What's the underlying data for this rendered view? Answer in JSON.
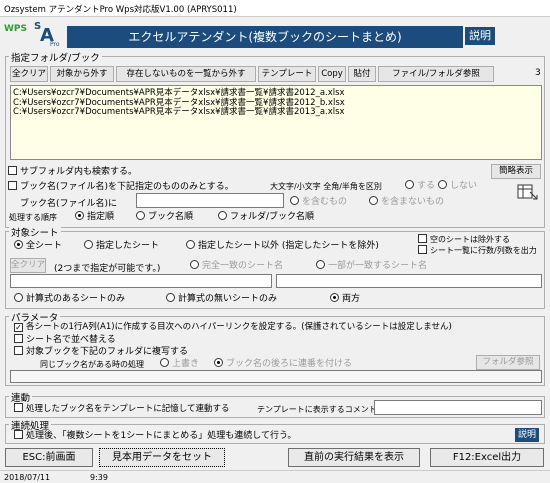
{
  "window": {
    "title": "Ozsystem アテンダントPro Wps対応版V1.00 (APRYS011)"
  },
  "logo": {
    "wps": "WPS",
    "s": "S",
    "a": "A",
    "pro": "Pro"
  },
  "banner": {
    "title": "エクセルアテンダント(複数ブックのシートまとめ)",
    "help": "説明"
  },
  "folder_group": {
    "label": "指定フォルダ/ブック",
    "buttons": [
      "全クリア",
      "対象から外す",
      "存在しないものを一覧から外す",
      "テンプレート",
      "Copy",
      "貼付",
      "ファイル/フォルダ参照"
    ],
    "count": "3",
    "files": [
      "C:¥Users¥ozcr7¥Documents¥APR見本データxlsx¥請求書一覧¥請求書2012_a.xlsx",
      "C:¥Users¥ozcr7¥Documents¥APR見本データxlsx¥請求書一覧¥請求書2012_b.xlsx",
      "C:¥Users¥ozcr7¥Documents¥APR見本データxlsx¥請求書一覧¥請求書2013_a.xlsx"
    ],
    "subfolder": "サブフォルダ内も検索する。",
    "simple_button": "簡略表示",
    "bookname_filter": "ブック名(ファイル名)を下記指定のもののみとする。",
    "case_label": "大文字/小文字 全角/半角を区別",
    "case_yes": "する",
    "case_no": "しない",
    "bookname_label": "ブック名(ファイル名)に",
    "contains": "を含むもの",
    "not_contains": "を含まないもの",
    "order_label": "処理する順序",
    "order_options": [
      "指定順",
      "ブック名順",
      "フォルダ/ブック名順"
    ]
  },
  "sheet_group": {
    "label": "対象シート",
    "options": [
      "全シート",
      "指定したシート",
      "指定したシート以外 (指定したシートを除外)"
    ],
    "exclude_empty": "空のシートは除外する",
    "output_rows": "シート一覧に行数/列数を出力",
    "clear": "全クリア",
    "note": "(2つまで指定が可能です。)",
    "match_full": "完全一致のシート名",
    "match_part": "一部が一致するシート名",
    "formula_options": [
      "計算式のあるシートのみ",
      "計算式の無いシートのみ",
      "両方"
    ]
  },
  "param_group": {
    "label": "パラメータ",
    "hyperlink": "各シートの1行A列(A1)に作成する目次へのハイパーリンクを設定する。(保護されているシートは設定しません)",
    "sort": "シート名で並べ替える",
    "copy_to_folder": "対象ブックを下記のフォルダに複写する",
    "same_name_label": "同じブック名がある時の処理",
    "overwrite": "上書き",
    "serial": "ブック名の後ろに連番を付ける",
    "folder_button": "フォルダ参照"
  },
  "link_group": {
    "label": "連動",
    "remember": "処理したブック名をテンプレートに記憶して連動する",
    "comment_label": "テンプレートに表示するコメント"
  },
  "cont_group": {
    "label": "連続処理",
    "continue": "処理後、「複数シートを1シートにまとめる」処理も連続して行う。",
    "help": "説明"
  },
  "bottom": {
    "esc": "ESC:前画面",
    "sample": "見本用データをセット",
    "last_result": "直前の実行結果を表示",
    "f12": "F12:Excel出力"
  },
  "status": {
    "date": "2018/07/11",
    "time": "9:39"
  }
}
